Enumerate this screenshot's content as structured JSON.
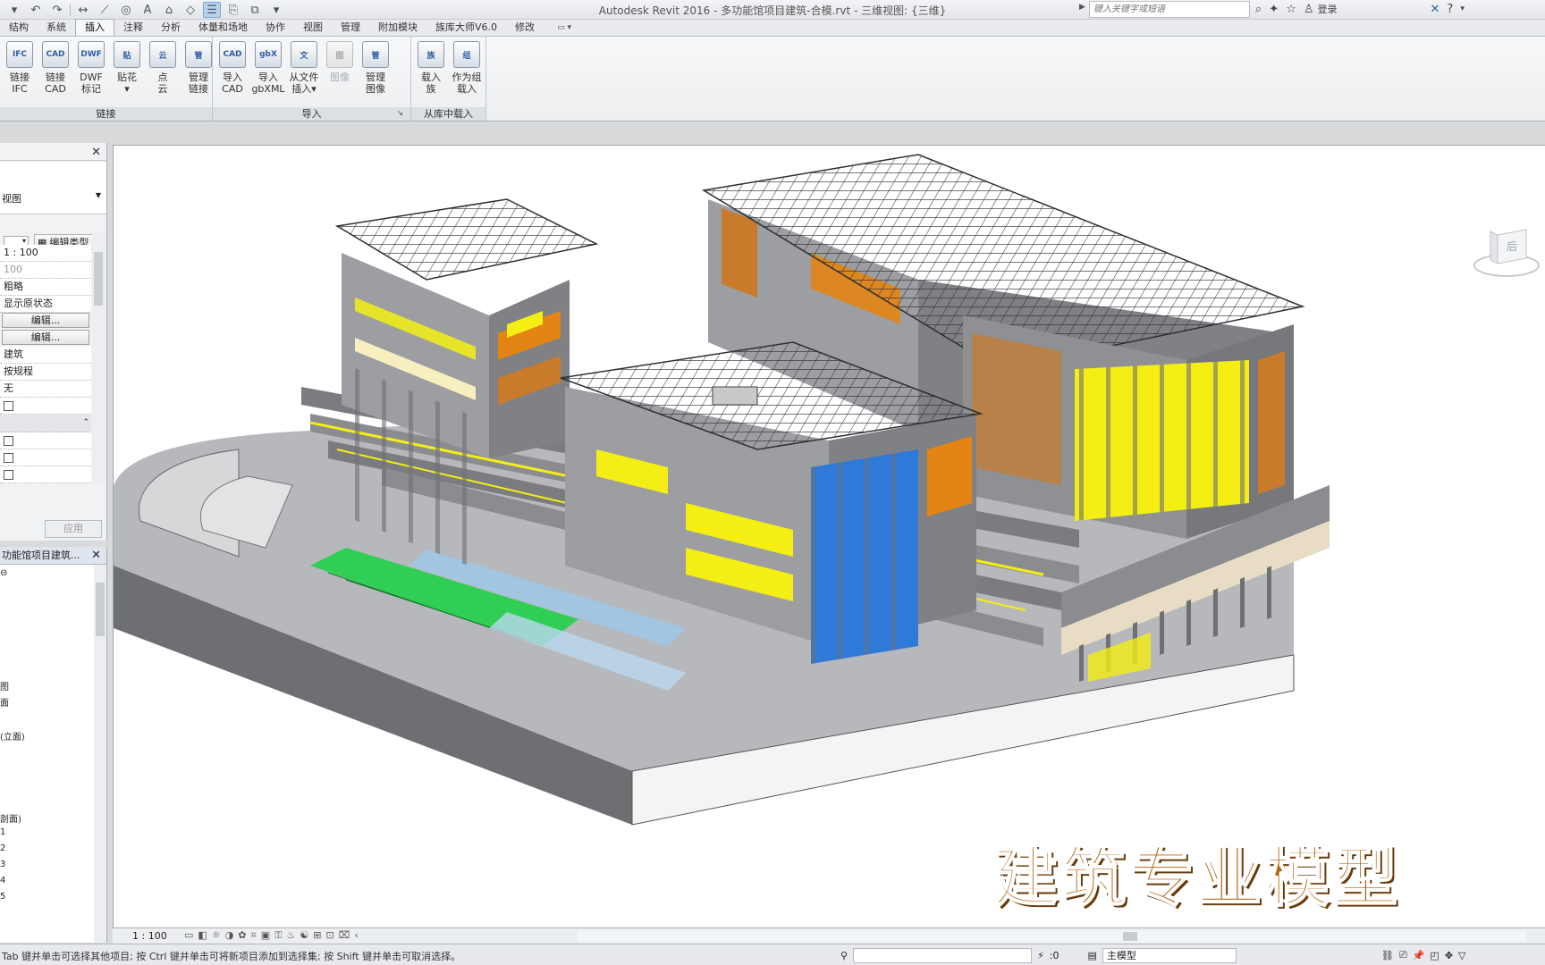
{
  "app": {
    "title": "Autodesk Revit 2016 -    多功能馆项目建筑-合模.rvt - 三维视图: {三维}",
    "search_placeholder": "键入关键字或短语",
    "login": "登录"
  },
  "tabs": [
    "结构",
    "系统",
    "插入",
    "注释",
    "分析",
    "体量和场地",
    "协作",
    "视图",
    "管理",
    "附加模块",
    "族库大师V6.0",
    "修改"
  ],
  "active_tab": "插入",
  "ribbon": {
    "groups": [
      {
        "title": "链接",
        "buttons": [
          {
            "icon": "IFC",
            "label": "链接\nIFC"
          },
          {
            "icon": "CAD",
            "label": "链接\nCAD"
          },
          {
            "icon": "DWF",
            "label": "DWF\n标记"
          },
          {
            "icon": "贴",
            "label": "贴花\n▾"
          },
          {
            "icon": "云",
            "label": "点\n云"
          },
          {
            "icon": "管",
            "label": "管理\n链接"
          }
        ]
      },
      {
        "title": "导入",
        "buttons": [
          {
            "icon": "CAD",
            "label": "导入\nCAD"
          },
          {
            "icon": "gbX",
            "label": "导入\ngbXML"
          },
          {
            "icon": "文",
            "label": "从文件\n插入▾"
          },
          {
            "icon": "图",
            "label": "图像",
            "disabled": true
          },
          {
            "icon": "管",
            "label": "管理\n图像"
          }
        ]
      },
      {
        "title": "从库中载入",
        "buttons": [
          {
            "icon": "族",
            "label": "载入\n族"
          },
          {
            "icon": "组",
            "label": "作为组\n载入"
          }
        ]
      }
    ]
  },
  "properties": {
    "type_name": "视图",
    "edit_type": "编辑类型",
    "rows": [
      "1 : 100",
      "100",
      "粗略",
      "显示原状态",
      "编辑...",
      "编辑...",
      "建筑",
      "按规程",
      "无"
    ],
    "apply": "应用"
  },
  "browser": {
    "title": "功能馆项目建筑...",
    "nodes": [
      "图",
      "面",
      "(立面)",
      "剖面)",
      "1",
      "2",
      "3",
      "4",
      "5"
    ]
  },
  "viewbar": {
    "scale": "1 : 100"
  },
  "watermark": "建筑专业模型",
  "status": {
    "text": "Tab 键并单击可选择其他项目; 按 Ctrl 键并单击可将新项目添加到选择集; 按 Shift 键并单击可取消选择。",
    "zero": ":0",
    "model": "主模型"
  },
  "colors": {
    "accent_tab": "#b8d2ee",
    "glass_yellow": "#f4ee14",
    "glass_blue": "#2f79d8",
    "green_zone": "#22d04a",
    "concrete": "#8e9094"
  }
}
